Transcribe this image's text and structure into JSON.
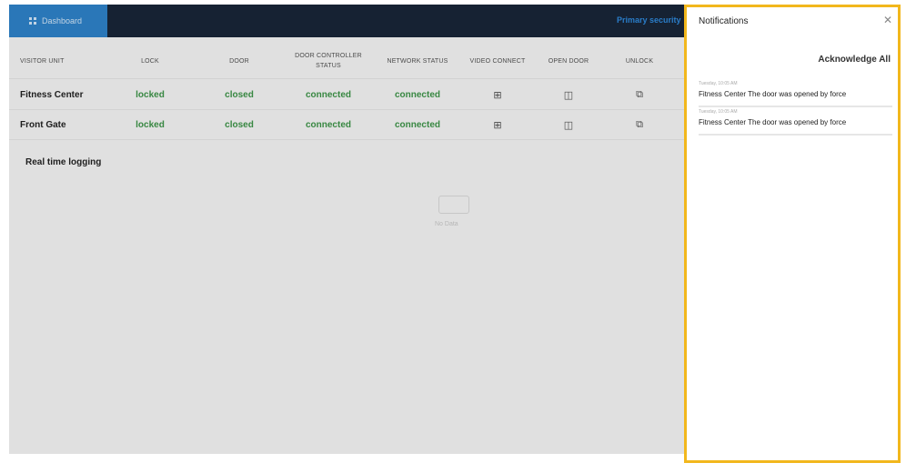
{
  "topbar": {
    "dashboard_tab": "Dashboard",
    "site_name": "Primary security"
  },
  "table": {
    "headers": [
      "VISITOR UNIT",
      "LOCK",
      "DOOR",
      "DOOR CONTROLLER STATUS",
      "NETWORK STATUS",
      "VIDEO CONNECT",
      "OPEN DOOR",
      "UNLOCK"
    ],
    "rows": [
      {
        "unit": "Fitness Center",
        "lock": "locked",
        "door": "closed",
        "controller": "connected",
        "network": "connected",
        "video_icon": "video-connect-icon",
        "open_icon": "open-door-icon",
        "unlock_icon": "link-icon"
      },
      {
        "unit": "Front Gate",
        "lock": "locked",
        "door": "closed",
        "controller": "connected",
        "network": "connected",
        "video_icon": "video-connect-icon",
        "open_icon": "open-door-icon",
        "unlock_icon": "link-icon"
      }
    ]
  },
  "logging": {
    "title": "Real time logging",
    "empty_text": "No Data"
  },
  "notifications": {
    "title": "Notifications",
    "acknowledge_all": "Acknowledge All",
    "items": [
      {
        "time": "Tuesday, 10:05 AM",
        "unit": "Fitness Center",
        "message": " The door was opened by force"
      },
      {
        "time": "Tuesday, 10:05 AM",
        "unit": "Fitness Center",
        "message": " The door was opened by force"
      }
    ]
  },
  "colors": {
    "topbar_bg": "#071629",
    "dashboard_tab_bg": "#1f79c4",
    "status_green": "#2e8b3a",
    "panel_highlight": "#f2b71c"
  }
}
